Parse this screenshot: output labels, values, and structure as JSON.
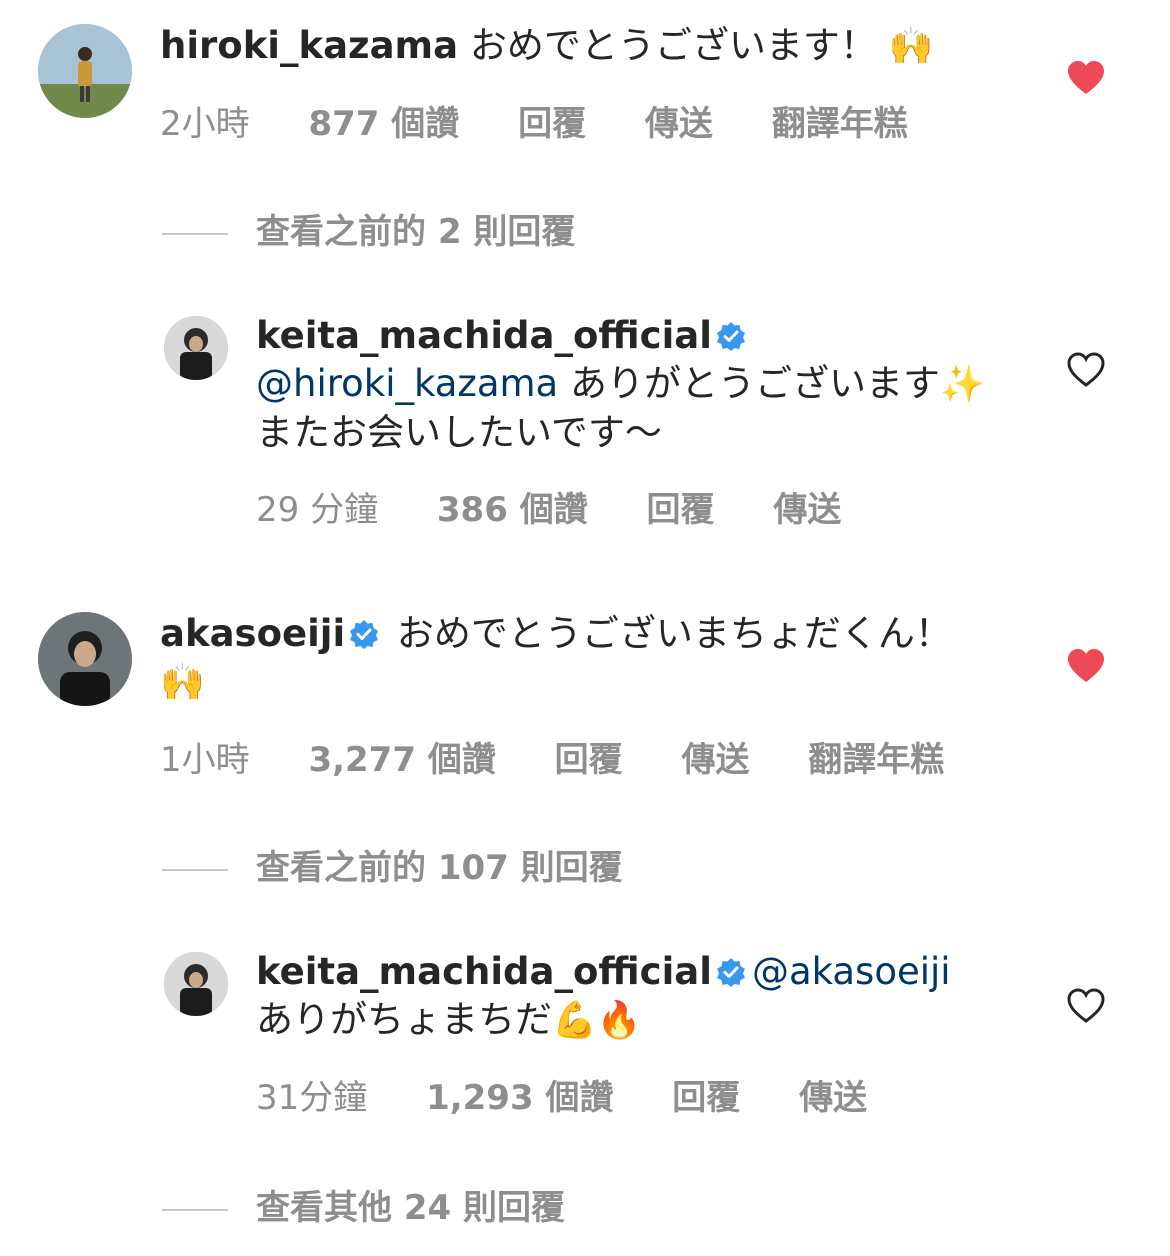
{
  "comments": [
    {
      "username": "hiroki_kazama",
      "verified": false,
      "text": "おめでとうございます！",
      "emoji": "🙌",
      "time": "2小時",
      "likes": "877 個讚",
      "reply": "回覆",
      "send": "傳送",
      "translate": "翻譯年糕",
      "liked": true,
      "view_replies": "查看之前的 2 則回覆"
    },
    {
      "username": "keita_machida_official",
      "verified": true,
      "mention": "@hiroki_kazama",
      "text_1": "ありがとうございます",
      "emoji": "✨",
      "text_2": "またお会いしたいです～",
      "time": "29 分鐘",
      "likes": "386 個讚",
      "reply": "回覆",
      "send": "傳送",
      "liked": false
    },
    {
      "username": "akasoeiji",
      "verified": true,
      "text": "おめでとうございまちょだくん！",
      "emoji": "🙌",
      "time": "1小時",
      "likes": "3,277 個讚",
      "reply": "回覆",
      "send": "傳送",
      "translate": "翻譯年糕",
      "liked": true,
      "view_replies": "查看之前的 107 則回覆"
    },
    {
      "username": "keita_machida_official",
      "verified": true,
      "mention": "@akasoeiji",
      "text": "ありがちょまちだ",
      "emoji_1": "💪",
      "emoji_2": "🔥",
      "time": "31分鐘",
      "likes": "1,293 個讚",
      "reply": "回覆",
      "send": "傳送",
      "liked": false,
      "view_replies": "查看其他 24 則回覆"
    }
  ],
  "colors": {
    "text": "#262626",
    "meta": "#8e8e8e",
    "mention": "#00376b",
    "heart_liked": "#ed4956",
    "verified": "#3897f0"
  }
}
